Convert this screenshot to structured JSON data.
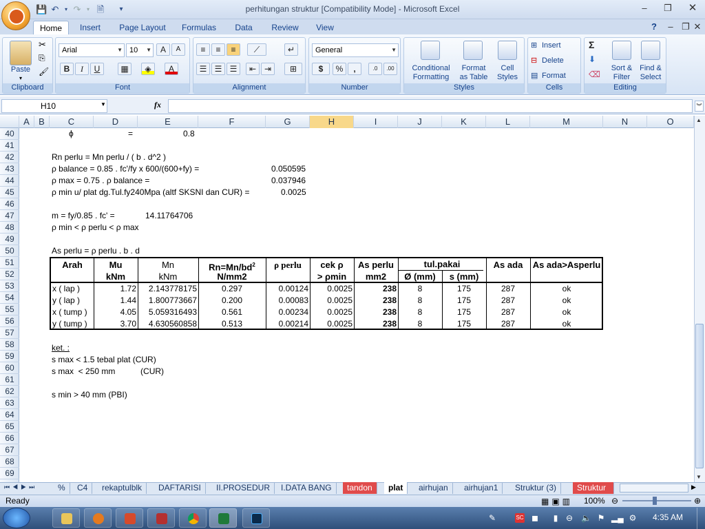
{
  "window": {
    "title": "perhitungan struktur  [Compatibility Mode] - Microsoft Excel"
  },
  "tabs": [
    "Home",
    "Insert",
    "Page Layout",
    "Formulas",
    "Data",
    "Review",
    "View"
  ],
  "ribbon": {
    "clipboard": {
      "label": "Clipboard",
      "paste": "Paste"
    },
    "font": {
      "label": "Font",
      "name": "Arial",
      "size": "10",
      "bold": "B",
      "italic": "I",
      "underline": "U"
    },
    "alignment": {
      "label": "Alignment"
    },
    "number": {
      "label": "Number",
      "format": "General",
      "currency": "$",
      "percent": "%",
      "comma": ","
    },
    "styles": {
      "label": "Styles",
      "cond1": "Conditional",
      "cond2": "Formatting",
      "fmt1": "Format",
      "fmt2": "as Table",
      "cell1": "Cell",
      "cell2": "Styles"
    },
    "cells": {
      "label": "Cells",
      "insert": "Insert",
      "delete": "Delete",
      "format": "Format"
    },
    "editing": {
      "label": "Editing",
      "sort1": "Sort &",
      "sort2": "Filter",
      "find1": "Find &",
      "find2": "Select"
    }
  },
  "namebox": "H10",
  "fx": "fx",
  "columns": [
    "A",
    "B",
    "C",
    "D",
    "E",
    "F",
    "G",
    "H",
    "I",
    "J",
    "K",
    "L",
    "M",
    "N",
    "O"
  ],
  "rows": [
    "40",
    "41",
    "42",
    "43",
    "44",
    "45",
    "46",
    "47",
    "48",
    "49",
    "50",
    "51",
    "52",
    "53",
    "54",
    "55",
    "56",
    "57",
    "58",
    "59",
    "60",
    "61",
    "62",
    "63",
    "64",
    "65",
    "66",
    "67",
    "68",
    "69"
  ],
  "cells": {
    "r40_phi": "ϕ",
    "r40_eq": "=",
    "r40_val": "0.8",
    "r42": "Rn perlu = Mn perlu / ( b . d^2 )",
    "r43": "ρ balance = 0.85 . fc'/fy   x  600/(600+fy)   =",
    "r43_val": "0.050595",
    "r44": "ρ max  = 0.75 . ρ balance        =",
    "r44_val": "0.037946",
    "r45": "ρ min u/ plat dg.Tul.fy240Mpa (altf SKSNI dan CUR)  =",
    "r45_val": "0.0025",
    "r47": "m = fy/0.85 . fc'  =",
    "r47_val": "14.11764706",
    "r48": "ρ min < ρ perlu <  ρ max",
    "r50": "As perlu = ρ perlu . b . d",
    "r58": "ket. :",
    "r59": "s max  < 1.5 tebal plat   (CUR)",
    "r60": "s max  < 250 mm           (CUR)",
    "r62": "s min  > 40 mm   (PBI)"
  },
  "table": {
    "h_arah": "Arah",
    "h_mu": "Mu",
    "h_mu_u": "kNm",
    "h_mn": "Mn",
    "h_mn_u": "kNm",
    "h_rn": "Rn=Mn/bd",
    "h_rn_sup": "2",
    "h_rn_u": "N/mm2",
    "h_rho": "ρ perlu",
    "h_cek": "cek ρ",
    "h_cek2": "> ρmin",
    "h_as": "As perlu",
    "h_as_u": "mm2",
    "h_tul": "tul.pakai",
    "h_dia": "Ø (mm)",
    "h_s": "s (mm)",
    "h_asada": "As ada",
    "h_ok": "As ada>Asperlu",
    "rows": [
      [
        "x ( lap )",
        "1.72",
        "2.143778175",
        "0.297",
        "0.00124",
        "0.0025",
        "238",
        "8",
        "175",
        "287",
        "ok"
      ],
      [
        "y ( lap )",
        "1.44",
        "1.800773667",
        "0.200",
        "0.00083",
        "0.0025",
        "238",
        "8",
        "175",
        "287",
        "ok"
      ],
      [
        "x ( tump )",
        "4.05",
        "5.059316493",
        "0.561",
        "0.00234",
        "0.0025",
        "238",
        "8",
        "175",
        "287",
        "ok"
      ],
      [
        "y ( tump )",
        "3.70",
        "4.630560858",
        "0.513",
        "0.00214",
        "0.0025",
        "238",
        "8",
        "175",
        "287",
        "ok"
      ]
    ]
  },
  "sheets": [
    "%",
    "C4",
    "rekaptulblk",
    "DAFTARISI",
    "II.PROSEDUR",
    "I.DATA BANG",
    "tandon",
    "plat",
    "airhujan",
    "airhujan1",
    "Struktur (3)",
    "Struktur"
  ],
  "status": {
    "ready": "Ready",
    "zoom": "100%"
  },
  "clock": "4:35 AM"
}
